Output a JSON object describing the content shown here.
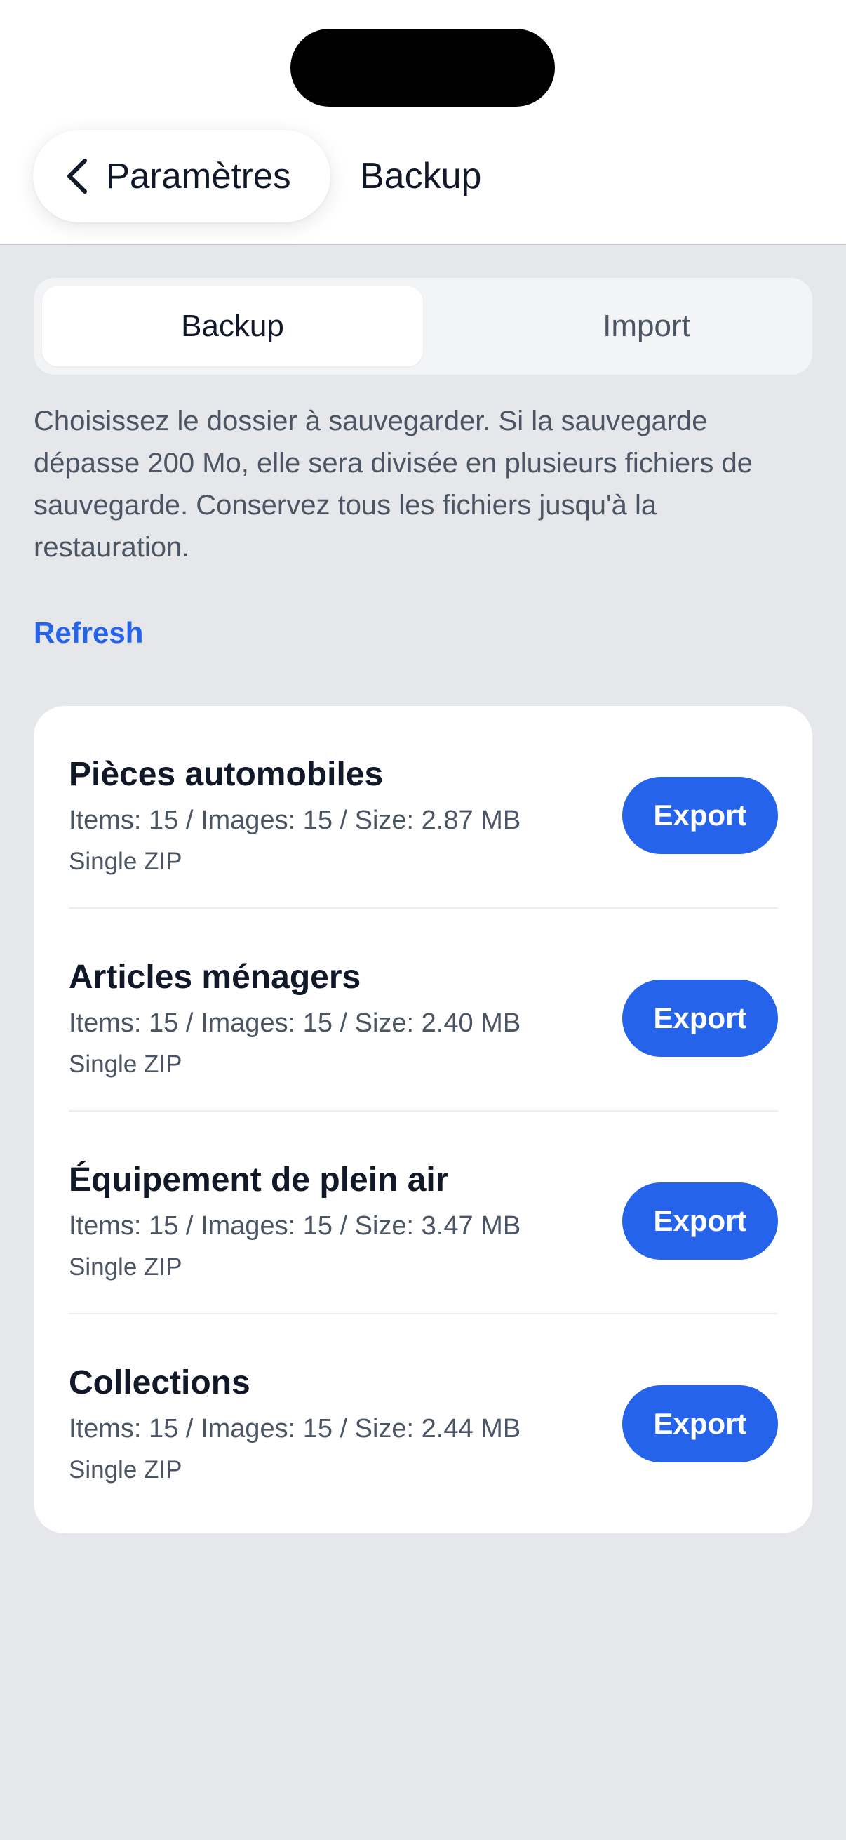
{
  "header": {
    "back_label": "Paramètres",
    "title": "Backup"
  },
  "tabs": [
    {
      "label": "Backup",
      "active": true
    },
    {
      "label": "Import",
      "active": false
    }
  ],
  "description": "Choisissez le dossier à sauvegarder. Si la sauvegarde dépasse 200 Mo, elle sera divisée en plusieurs fichiers de sauvegarde. Conservez tous les fichiers jusqu'à la restauration.",
  "refresh_label": "Refresh",
  "folders": [
    {
      "name": "Pièces automobiles",
      "stats": "Items: 15 / Images: 15 / Size: 2.87 MB",
      "mode": "Single ZIP",
      "action": "Export"
    },
    {
      "name": "Articles ménagers",
      "stats": "Items: 15 / Images: 15 / Size: 2.40 MB",
      "mode": "Single ZIP",
      "action": "Export"
    },
    {
      "name": "Équipement de plein air",
      "stats": "Items: 15 / Images: 15 / Size: 3.47 MB",
      "mode": "Single ZIP",
      "action": "Export"
    },
    {
      "name": "Collections",
      "stats": "Items: 15 / Images: 15 / Size: 2.44 MB",
      "mode": "Single ZIP",
      "action": "Export"
    }
  ],
  "colors": {
    "accent": "#2563eb",
    "background": "#e5e7eb",
    "card": "#ffffff",
    "text_primary": "#111827",
    "text_secondary": "#4b5563"
  },
  "icons": {
    "back": "chevron-left-icon"
  }
}
